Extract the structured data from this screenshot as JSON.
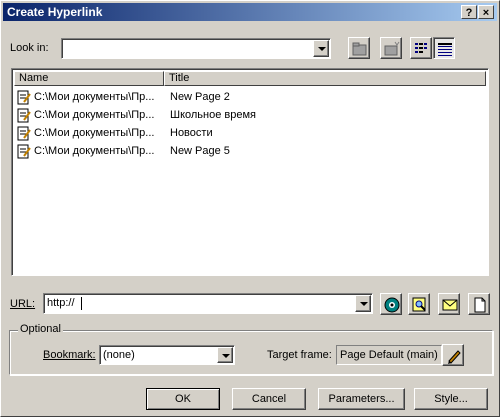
{
  "window": {
    "title": "Create Hyperlink",
    "help_label": "?",
    "close_label": "×"
  },
  "look_in": {
    "label": "Look in:",
    "value": ""
  },
  "list": {
    "columns": [
      "Name",
      "Title"
    ],
    "rows": [
      {
        "name": "C:\\Мои документы\\Пр...",
        "title": "New Page 2"
      },
      {
        "name": "C:\\Мои документы\\Пр...",
        "title": "Школьное время"
      },
      {
        "name": "C:\\Мои документы\\Пр...",
        "title": "Новости"
      },
      {
        "name": "C:\\Мои документы\\Пр...",
        "title": "New Page 5"
      }
    ]
  },
  "url": {
    "label": "URL:",
    "value": "http://"
  },
  "optional": {
    "legend": "Optional",
    "bookmark_label": "Bookmark:",
    "bookmark_value": "(none)",
    "target_label": "Target frame:",
    "target_value": "Page Default (main)"
  },
  "buttons": {
    "ok": "OK",
    "cancel": "Cancel",
    "parameters": "Parameters...",
    "style": "Style..."
  },
  "colors": {
    "face": "#d4d0c8",
    "title_start": "#0a246a",
    "title_end": "#a6caf0"
  }
}
